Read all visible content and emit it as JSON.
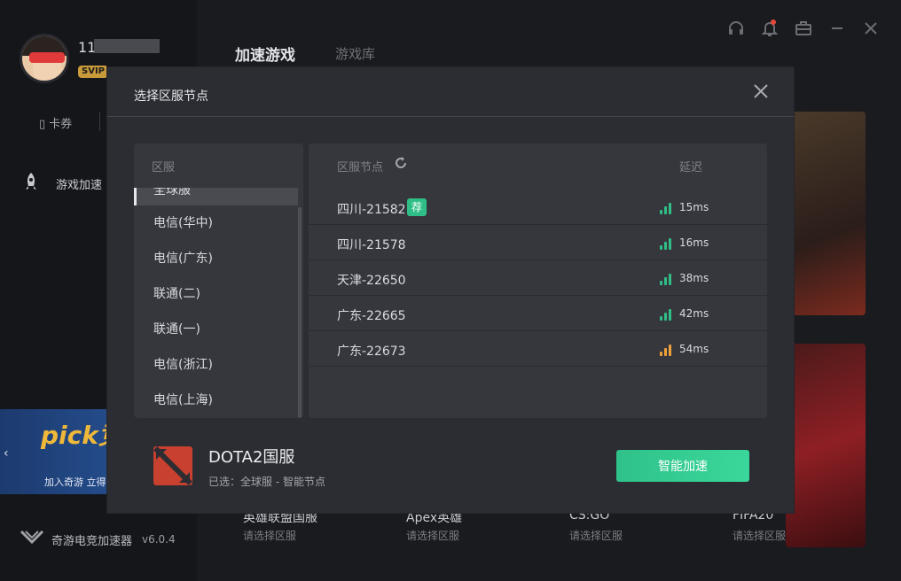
{
  "sidebar": {
    "username": "11",
    "vip": "SVIP",
    "coupon": "卡券",
    "nav_game_accel": "游戏加速",
    "banner_text": "pick竞技",
    "banner_sub": "加入奇游 立得",
    "brand": "奇游电竞加速器",
    "version": "v6.0.4"
  },
  "header": {
    "tab_active": "加速游戏",
    "tab_library": "游戏库"
  },
  "cards": {
    "lol_sub": "请选择区服",
    "apex_title": "Apex英雄",
    "apex_sub": "请选择区服",
    "lol_title": "英雄联盟国服",
    "csgo_title": "CS:GO",
    "csgo_sub": "请选择区服",
    "fifa_title": "FIFA20",
    "fifa_sub": "请选择区服",
    "lol_bottom_sub": "请选择区服"
  },
  "modal": {
    "title": "选择区服节点",
    "region_header": "区服",
    "regions": [
      "全球服",
      "电信(华中)",
      "电信(广东)",
      "联通(二)",
      "联通(一)",
      "电信(浙江)",
      "电信(上海)"
    ],
    "node_header": "区服节点",
    "latency_header": "延迟",
    "nodes": [
      {
        "name": "四川-21582",
        "badge": "荐",
        "ms": "15ms",
        "color": "#2fbf86"
      },
      {
        "name": "四川-21578",
        "badge": "",
        "ms": "16ms",
        "color": "#2fbf86"
      },
      {
        "name": "天津-22650",
        "badge": "",
        "ms": "38ms",
        "color": "#2fbf86"
      },
      {
        "name": "广东-22665",
        "badge": "",
        "ms": "42ms",
        "color": "#2fbf86"
      },
      {
        "name": "广东-22673",
        "badge": "",
        "ms": "54ms",
        "color": "#f0a23a"
      }
    ],
    "game_name": "DOTA2国服",
    "selected_info": "已选：全球服 - 智能节点",
    "accelerate_label": "智能加速"
  }
}
